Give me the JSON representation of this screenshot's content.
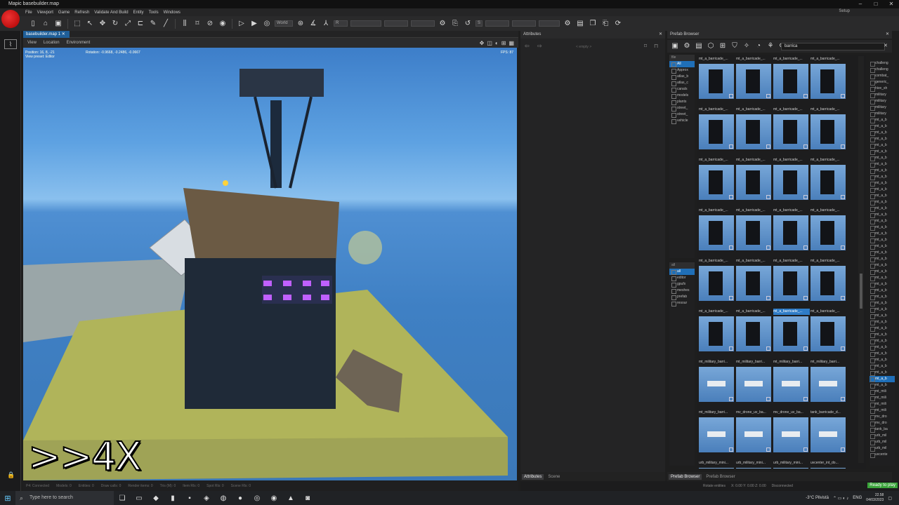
{
  "window": {
    "title": "Mapic basebuilder.map",
    "controls": [
      "–",
      "□",
      "✕"
    ]
  },
  "menu": {
    "items": [
      "File",
      "Viewport",
      "Game",
      "Refresh",
      "Validate And Build",
      "Entity",
      "Tools",
      "Windows"
    ],
    "setup": "Setup"
  },
  "toolbar": {
    "space": "World",
    "r_label": "R",
    "s_label": "S"
  },
  "viewport": {
    "tab": "basebuilder.map 1",
    "sub_items": [
      "View",
      "Location",
      "Environment"
    ],
    "position": "Position: 16, 8, -21",
    "view_preset": "View preset: Editor",
    "rotation": "Rotation: -0.9668, -0.2486, -0.0667",
    "fps": "FPS: 87",
    "speed_label": ">>4X",
    "status": [
      "P4: Connected",
      "Models: 0",
      "Entities: 0",
      "Draw calls: 0",
      "Render items: 0",
      "Tris (M): 0",
      "Item Rls: 0",
      "Spot Rls: 0",
      "Scene Rls: 0"
    ]
  },
  "attributes": {
    "title": "Attributes",
    "empty": "< empty >",
    "tabs": [
      "Attributes",
      "Scene"
    ]
  },
  "prefab": {
    "title": "Prefab Browser",
    "search": "barrica",
    "tree1_head": "file",
    "tree1": [
      "All",
      "Approx",
      "atlas_b",
      "atlas_c",
      "canals",
      "models",
      "plants",
      "street_",
      "street_",
      "vehicle"
    ],
    "tree2_head": "all",
    "tree2": [
      "all",
      "editor",
      "gpufx",
      "meshes",
      "prefab",
      "resour"
    ],
    "captions": [
      "mt_a_barricade_...",
      "mt_a_barricade_...",
      "mt_a_barricade_...",
      "mt_a_barricade_...",
      "mt_a_barricade_...",
      "mt_a_barricade_...",
      "mt_a_barricade_...",
      "mt_a_barricade_...",
      "mt_a_barricade_...",
      "mt_a_barricade_...",
      "mt_a_barricade_...",
      "mt_a_barricade_...",
      "mt_a_barricade_...",
      "mt_a_barricade_...",
      "mt_a_barricade_...",
      "mt_a_barricade_...",
      "mt_a_barricade_...",
      "mt_a_barricade_...",
      "mt_a_barricade_...",
      "mt_a_barricade_...",
      "mt_a_barricade_...",
      "mt_a_barricade_...",
      "mt_a_barricade_...",
      "mt_a_barricade_...",
      "mt_military_barri...",
      "mt_military_barri...",
      "mt_military_barri...",
      "mt_military_barri...",
      "mt_military_barri...",
      "mv_drone_uv_ba...",
      "mv_drone_uv_ba...",
      "tank_barricade_d...",
      "urb_military_mini...",
      "urb_military_mini...",
      "urb_military_mini...",
      "uvcenter_int_do..."
    ],
    "list": [
      "challeng",
      "challeng",
      "combat_",
      "generic_",
      "hive_sh",
      "military",
      "military",
      "military",
      "military",
      "mt_a_b",
      "mt_a_b",
      "mt_a_b",
      "mt_a_b",
      "mt_a_b",
      "mt_a_b",
      "mt_a_b",
      "mt_a_b",
      "mt_a_b",
      "mt_a_b",
      "mt_a_b",
      "mt_a_b",
      "mt_a_b",
      "mt_a_b",
      "mt_a_b",
      "mt_a_b",
      "mt_a_b",
      "mt_a_b",
      "mt_a_b",
      "mt_a_b",
      "mt_a_b",
      "mt_a_b",
      "mt_a_b",
      "mt_a_b",
      "mt_a_b",
      "mt_a_b",
      "mt_a_b",
      "mt_a_b",
      "mt_a_b",
      "mt_a_b",
      "mt_a_b",
      "mt_a_b",
      "mt_a_b",
      "mt_a_b",
      "mt_a_b",
      "mt_a_b",
      "mt_a_b",
      "mt_a_b",
      "mt_a_b",
      "mt_a_b",
      "mt_a_b",
      "mt_a_b",
      "mt_a_b",
      "mt_mili",
      "mt_mili",
      "mt_mili",
      "mt_mili",
      "mv_dro",
      "mv_dro",
      "tank_ba",
      "urb_mil",
      "urb_mil",
      "urb_mil",
      "uvcente"
    ],
    "tabs": [
      "Prefab Browser",
      "Prefab Browser"
    ]
  },
  "status": {
    "rotate": "Rotate entities",
    "coords": "X: 0.00  Y: 0.00  Z: 0.00",
    "disconnected": "Disconnected",
    "ready": "Ready to play"
  },
  "taskbar": {
    "search": "Type here to search",
    "weather": "-3°C  Pilvistä",
    "lang": "ENG",
    "time": "22.58",
    "date": "04/03/2023"
  }
}
